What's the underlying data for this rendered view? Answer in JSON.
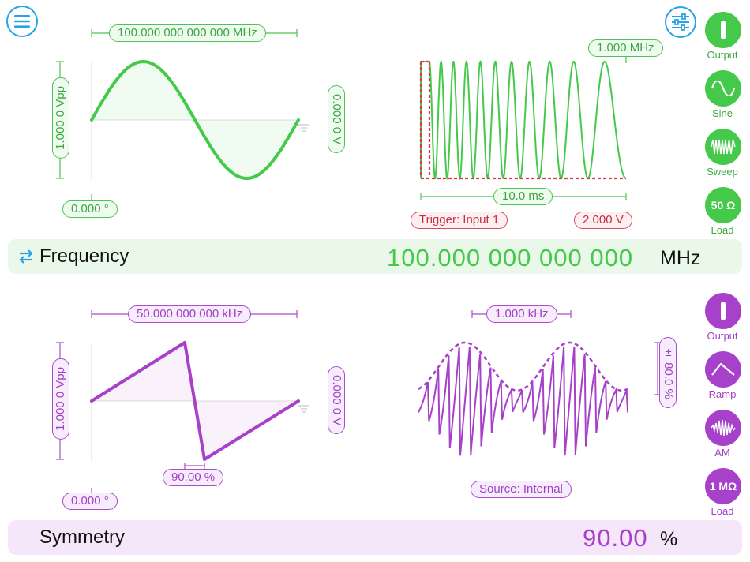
{
  "app": {
    "colors": {
      "green": "#44c94a",
      "red": "#d63a4a",
      "purple": "#a741c9",
      "blue": "#28a4e6"
    },
    "top_left_icon": "menu-icon",
    "top_right_icon": "sliders-icon"
  },
  "channel1": {
    "frequency_label": "100.000 000 000 000 MHz",
    "amplitude_label": "1.000 0 Vpp",
    "offset_label": "0.000 0 V",
    "phase_label": "0.000 °",
    "sweep_rate_label": "1.000 MHz",
    "sweep_time_label": "10.0 ms",
    "trigger_label": "Trigger: Input 1",
    "trigger_level_label": "2.000 V",
    "buttons": [
      {
        "label": "Output",
        "icon": "power-icon"
      },
      {
        "label": "Sine",
        "icon": "sine-wave-icon"
      },
      {
        "label": "Sweep",
        "icon": "sweep-wave-icon"
      },
      {
        "label": "Load",
        "icon": "load-icon",
        "text": "50 Ω"
      }
    ],
    "bar": {
      "title": "Frequency",
      "value": "100.000 000 000 000",
      "unit": "MHz",
      "icon": "swap-arrows-icon"
    }
  },
  "channel2": {
    "frequency_label": "50.000 000 000 kHz",
    "amplitude_label": "1.000 0 Vpp",
    "offset_label": "0.000 0 V",
    "phase_label": "0.000 °",
    "symmetry_label": "90.00 %",
    "mod_rate_label": "1.000 kHz",
    "mod_depth_label": "± 80.0 %",
    "source_label": "Source: Internal",
    "buttons": [
      {
        "label": "Output",
        "icon": "power-icon"
      },
      {
        "label": "Ramp",
        "icon": "ramp-wave-icon"
      },
      {
        "label": "AM",
        "icon": "am-wave-icon"
      },
      {
        "label": "Load",
        "icon": "load-icon",
        "text": "1 MΩ"
      }
    ],
    "bar": {
      "title": "Symmetry",
      "value": "90.00",
      "unit": "%"
    }
  }
}
